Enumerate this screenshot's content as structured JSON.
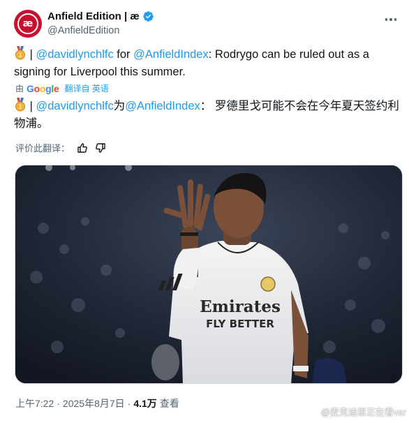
{
  "author": {
    "display_name": "Anfield Edition | æ",
    "handle": "@AnfieldEdition",
    "avatar_text": "æ",
    "brand_color": "#c8102e"
  },
  "tweet": {
    "separator": "|",
    "mention_source": "@davidlynchlfc",
    "word_for": "for",
    "mention_outlet": "@AnfieldIndex",
    "text_rest": ": Rodrygo can be ruled out as a signing for Liverpool this summer."
  },
  "translation": {
    "by_label": "由",
    "engine": "Google",
    "translated_from": "翻译自 英语",
    "separator": "|",
    "mention_source": "@davidlynchlfc",
    "word_for": "为",
    "mention_outlet": "@AnfieldIndex",
    "text_rest": "： 罗德里戈可能不会在今年夏天签约利物浦。"
  },
  "rate": {
    "label": "评价此翻译："
  },
  "media": {
    "jersey_sponsor_line1": "Emirates",
    "jersey_sponsor_line2": "FLY BETTER"
  },
  "footer": {
    "time": "上午7:22",
    "dot": "·",
    "date": "2025年8月7日",
    "views": "4.1万",
    "views_label": "查看"
  },
  "watermark": {
    "text": "@麦克迪恩正在看var"
  },
  "colors": {
    "link": "#1d9bf0",
    "secondary_text": "#536471",
    "verified": "#1d9bf0"
  }
}
